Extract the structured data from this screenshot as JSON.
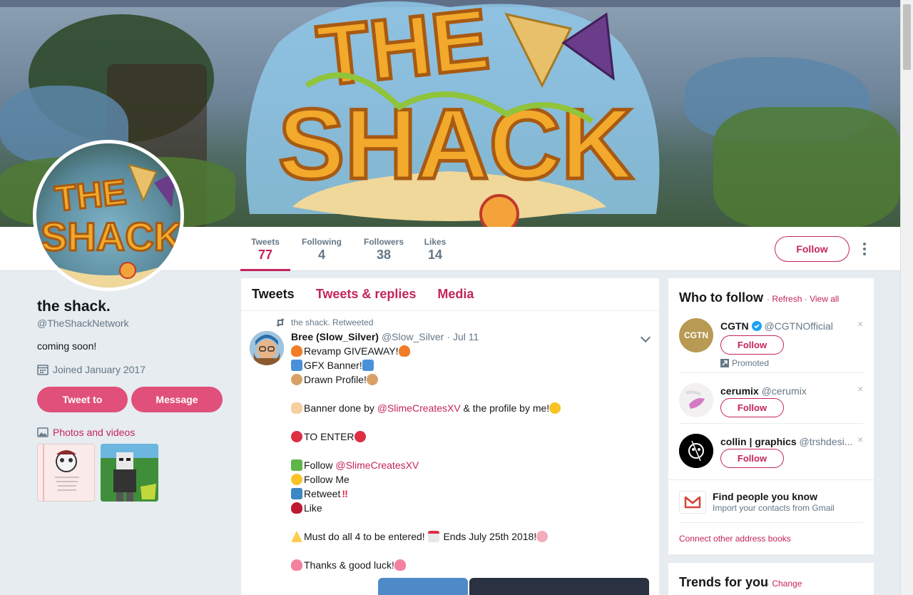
{
  "banner": {
    "logo_text": "THE SHACK"
  },
  "nav": {
    "stats": [
      {
        "label": "Tweets",
        "value": "77"
      },
      {
        "label": "Following",
        "value": "4"
      },
      {
        "label": "Followers",
        "value": "38"
      },
      {
        "label": "Likes",
        "value": "14"
      }
    ],
    "follow_label": "Follow"
  },
  "profile": {
    "name": "the shack.",
    "handle": "@TheShackNetwork",
    "bio": "coming soon!",
    "joined": "Joined January 2017",
    "tweet_to_label": "Tweet to",
    "message_label": "Message",
    "photos_label": "Photos and videos"
  },
  "timeline": {
    "tabs": [
      "Tweets",
      "Tweets & replies",
      "Media"
    ],
    "retweet_line": "the shack. Retweeted",
    "tweet": {
      "name": "Bree (Slow_Silver)",
      "handle": "@Slow_Silver",
      "dot": "·",
      "date": "Jul 11",
      "lines": [
        "Revamp GIVEAWAY!",
        "GFX Banner!",
        "Drawn Profile!",
        "",
        "Banner done by ",
        "",
        "TO ENTER",
        "",
        "Follow ",
        "Follow Me",
        "Retweet",
        "Like",
        "",
        "Must do all 4 to be entered! ",
        "",
        "Thanks & good luck!"
      ],
      "mention_1": "@SlimeCreatesXV",
      "after_mention_1": " & the profile by me!",
      "mention_2": "@SlimeCreatesXV",
      "ends_text": " Ends July 25th 2018!"
    }
  },
  "who_to_follow": {
    "title": "Who to follow",
    "refresh": "Refresh",
    "view_all": "View all",
    "sep": "·",
    "accounts": [
      {
        "name": "CGTN",
        "handle": "@CGTNOfficial",
        "follow": "Follow",
        "promoted": "Promoted",
        "avatar_text": "CGTN"
      },
      {
        "name": "cerumix",
        "handle": "@cerumix",
        "follow": "Follow"
      },
      {
        "name": "collin | graphics",
        "handle": "@trshdesi...",
        "follow": "Follow"
      }
    ],
    "close": "×",
    "find_title": "Find people you know",
    "find_sub": "Import your contacts from Gmail",
    "connect": "Connect other address books"
  },
  "trends": {
    "title": "Trends for you",
    "change": "Change",
    "sep": "·"
  },
  "colors": {
    "accent": "#c5245d",
    "button": "#e0507a",
    "background": "#e6ecf0"
  }
}
